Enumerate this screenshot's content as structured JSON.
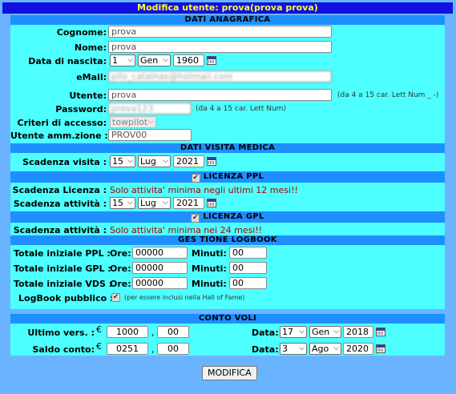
{
  "title": "Modifica utente: prova(prova prova)",
  "sections": {
    "anagrafica": "DATI ANAGRAFICA",
    "visita": "DATI VISITA MEDICA",
    "ppl": "LICENZA PPL",
    "gpl": "LICENZA GPL",
    "logbook": "GES TIONE LOGBOOK",
    "conto": "CONTO VOLI"
  },
  "anagrafica": {
    "cognome_label": "Cognome:",
    "cognome_value": "prova",
    "nome_label": "Nome:",
    "nome_value": "prova",
    "nascita_label": "Data di nascita:",
    "nascita_day": "1",
    "nascita_month": "Gen",
    "nascita_year": "1960",
    "email_label": "eMail:",
    "email_value": "pilo_catalnas@hotmail.com",
    "utente_label": "Utente:",
    "utente_value": "prova",
    "utente_note": "(da 4 a 15 car. Lett Num _ -)",
    "password_label": "Password:",
    "password_value": "prova123",
    "password_note": "(da 4 a 15 car. Lett Num)",
    "criteri_label": "Criteri di accesso:",
    "criteri_value": "towpilot",
    "amm_label": "Utente amm.zione :",
    "amm_placeholder": "PROV00"
  },
  "visita": {
    "scadenza_label": "Scadenza visita :",
    "day": "15",
    "month": "Lug",
    "year": "2021"
  },
  "ppl": {
    "licenza_label": "Scadenza Licenza :",
    "licenza_warning": "Solo attivita' minima negli ultimi 12 mesi!!",
    "attivita_label": "Scadenza attività :",
    "day": "15",
    "month": "Lug",
    "year": "2021"
  },
  "gpl": {
    "attivita_label": "Scadenza attività :",
    "attivita_warning": "Solo attivita' minima nei 24 mesi!!"
  },
  "logbook": {
    "ore_label": "Ore:",
    "minuti_label": "Minuti:",
    "rows": [
      {
        "label": "Totale iniziale PPL :",
        "ore": "00000",
        "minuti": "00"
      },
      {
        "label": "Totale iniziale GPL :",
        "ore": "00000",
        "minuti": "00"
      },
      {
        "label": "Totale iniziale VDS :",
        "ore": "00000",
        "minuti": "00"
      }
    ],
    "pubblico_label": "LogBook pubblico :",
    "pubblico_note": "(per essere inclusi nella Hall of Fame)"
  },
  "conto": {
    "euro": "€",
    "data_label": "Data:",
    "ultimo_label": "Ultimo vers. :",
    "ultimo_int": "1000",
    "ultimo_dec": "00",
    "ultimo_day": "17",
    "ultimo_month": "Gen",
    "ultimo_year": "2018",
    "saldo_label": "Saldo conto:",
    "saldo_int": "0251",
    "saldo_dec": "00",
    "saldo_day": "3",
    "saldo_month": "Ago",
    "saldo_year": "2020"
  },
  "submit_label": "MODIFICA",
  "icons": {
    "calendar": "calendar-icon",
    "checkbox": "check-icon",
    "dropdown": "chevron-down-icon"
  },
  "colors": {
    "background": "#6ab4ff",
    "title_bar": "#1010e0",
    "title_text": "#ffff33",
    "panel": "#4dffff",
    "section_header": "#1e8fff",
    "warning": "#b00000"
  }
}
